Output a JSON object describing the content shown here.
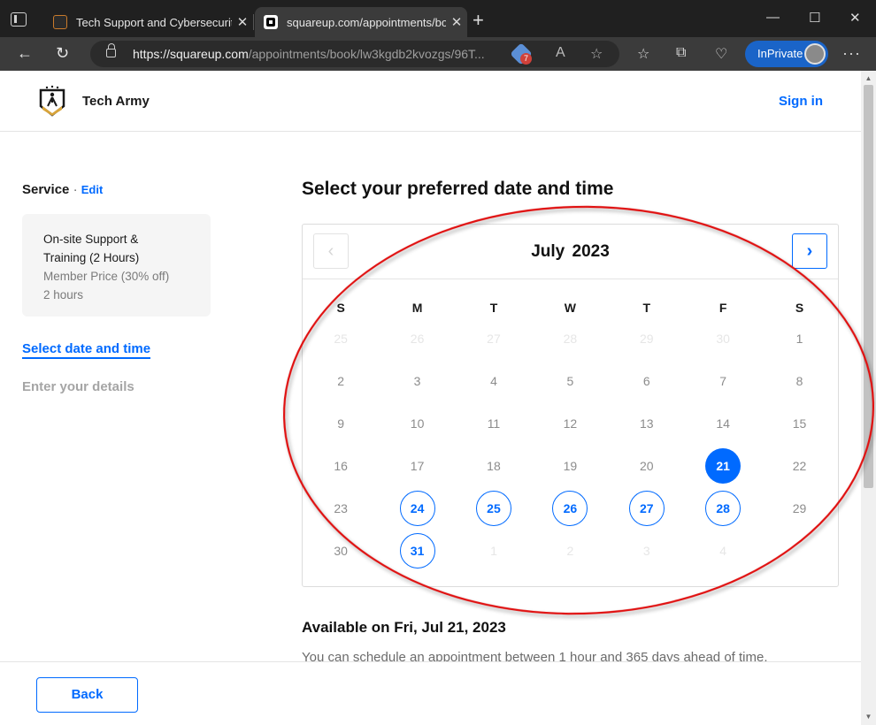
{
  "browser": {
    "tabs": [
      {
        "title": "Tech Support and Cybersecurity"
      },
      {
        "title": "squareup.com/appointments/bo"
      }
    ],
    "url_host": "https://squareup.com",
    "url_path": "/appointments/book/lw3kgdb2kvozgs/96T...",
    "extension_badge": "7",
    "inprivate_label": "InPrivate"
  },
  "header": {
    "brand": "Tech Army",
    "sign_in": "Sign in"
  },
  "sidebar": {
    "service_label": "Service",
    "separator": "·",
    "edit_label": "Edit",
    "service_card": {
      "name_line1": "On-site Support &",
      "name_line2": "Training (2 Hours)",
      "price": "Member Price (30% off)",
      "duration": "2 hours"
    },
    "steps": [
      {
        "label": "Select date and time"
      },
      {
        "label": "Enter your details"
      }
    ]
  },
  "main": {
    "title": "Select your preferred date and time",
    "calendar": {
      "month": "July",
      "year": "2023",
      "prev_glyph": "‹",
      "next_glyph": "›",
      "weekdays": [
        "S",
        "M",
        "T",
        "W",
        "T",
        "F",
        "S"
      ],
      "weeks": [
        [
          {
            "d": "25",
            "s": "out"
          },
          {
            "d": "26",
            "s": "out"
          },
          {
            "d": "27",
            "s": "out"
          },
          {
            "d": "28",
            "s": "out"
          },
          {
            "d": "29",
            "s": "out"
          },
          {
            "d": "30",
            "s": "out"
          },
          {
            "d": "1",
            "s": "normal"
          }
        ],
        [
          {
            "d": "2",
            "s": "normal"
          },
          {
            "d": "3",
            "s": "normal"
          },
          {
            "d": "4",
            "s": "normal"
          },
          {
            "d": "5",
            "s": "normal"
          },
          {
            "d": "6",
            "s": "normal"
          },
          {
            "d": "7",
            "s": "normal"
          },
          {
            "d": "8",
            "s": "normal"
          }
        ],
        [
          {
            "d": "9",
            "s": "normal"
          },
          {
            "d": "10",
            "s": "normal"
          },
          {
            "d": "11",
            "s": "normal"
          },
          {
            "d": "12",
            "s": "normal"
          },
          {
            "d": "13",
            "s": "normal"
          },
          {
            "d": "14",
            "s": "normal"
          },
          {
            "d": "15",
            "s": "normal"
          }
        ],
        [
          {
            "d": "16",
            "s": "normal"
          },
          {
            "d": "17",
            "s": "normal"
          },
          {
            "d": "18",
            "s": "normal"
          },
          {
            "d": "19",
            "s": "normal"
          },
          {
            "d": "20",
            "s": "normal"
          },
          {
            "d": "21",
            "s": "selected"
          },
          {
            "d": "22",
            "s": "normal"
          }
        ],
        [
          {
            "d": "23",
            "s": "normal"
          },
          {
            "d": "24",
            "s": "available"
          },
          {
            "d": "25",
            "s": "available"
          },
          {
            "d": "26",
            "s": "available"
          },
          {
            "d": "27",
            "s": "available"
          },
          {
            "d": "28",
            "s": "available"
          },
          {
            "d": "29",
            "s": "normal"
          }
        ],
        [
          {
            "d": "30",
            "s": "normal"
          },
          {
            "d": "31",
            "s": "available"
          },
          {
            "d": "1",
            "s": "out"
          },
          {
            "d": "2",
            "s": "out"
          },
          {
            "d": "3",
            "s": "out"
          },
          {
            "d": "4",
            "s": "out"
          },
          {
            "d": "",
            "s": "out"
          }
        ]
      ]
    },
    "available_title": "Available on Fri, Jul 21, 2023",
    "available_note": "You can schedule an appointment between 1 hour and 365 days ahead of time."
  },
  "footer": {
    "back_label": "Back"
  },
  "colors": {
    "accent": "#006aff",
    "annotation_red": "#e01010",
    "brand_gold": "#d8a43a"
  }
}
